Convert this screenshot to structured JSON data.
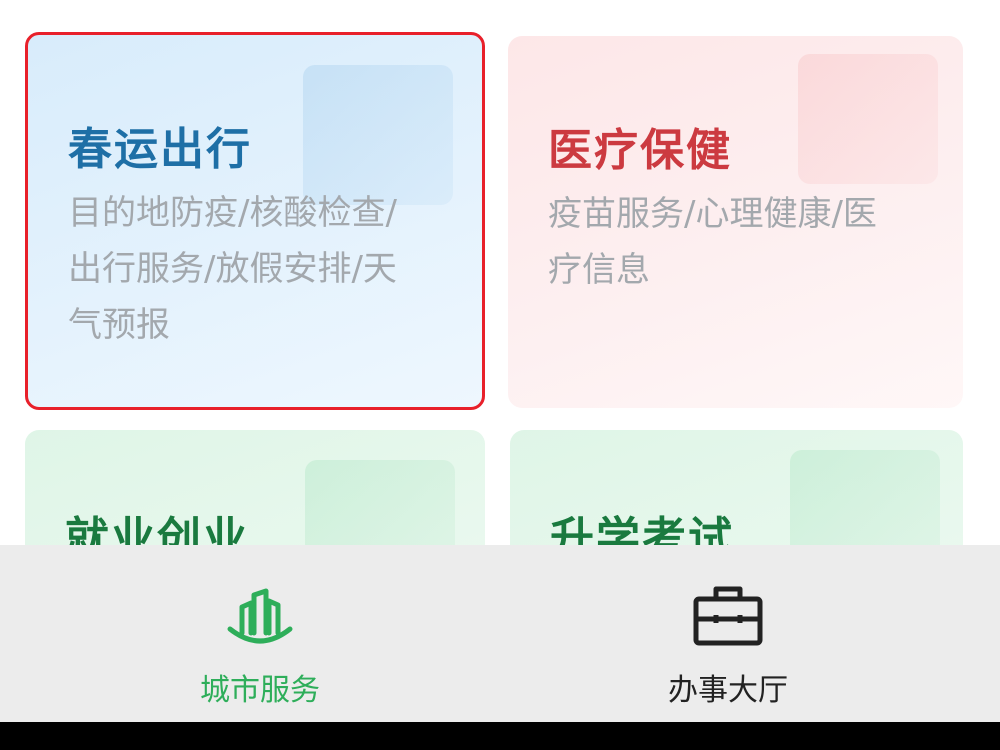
{
  "cards": [
    {
      "title": "春运出行",
      "description": "目的地防疫/核酸检查/出行服务/放假安排/天气预报",
      "selected": true
    },
    {
      "title": "医疗保健",
      "description": "疫苗服务/心理健康/医疗信息",
      "selected": false
    },
    {
      "title": "就业创业",
      "description": "",
      "selected": false
    },
    {
      "title": "升学考试",
      "description": "",
      "selected": false
    }
  ],
  "tabbar": {
    "items": [
      {
        "label": "城市服务",
        "icon": "city-buildings-icon",
        "active": true
      },
      {
        "label": "办事大厅",
        "icon": "briefcase-icon",
        "active": false
      }
    ]
  },
  "colors": {
    "selected_border": "#e8202a",
    "active_tab": "#2eae5a",
    "travel_title": "#1e6fa6",
    "medical_title": "#cc3a40",
    "green_title": "#1a7a3f"
  }
}
